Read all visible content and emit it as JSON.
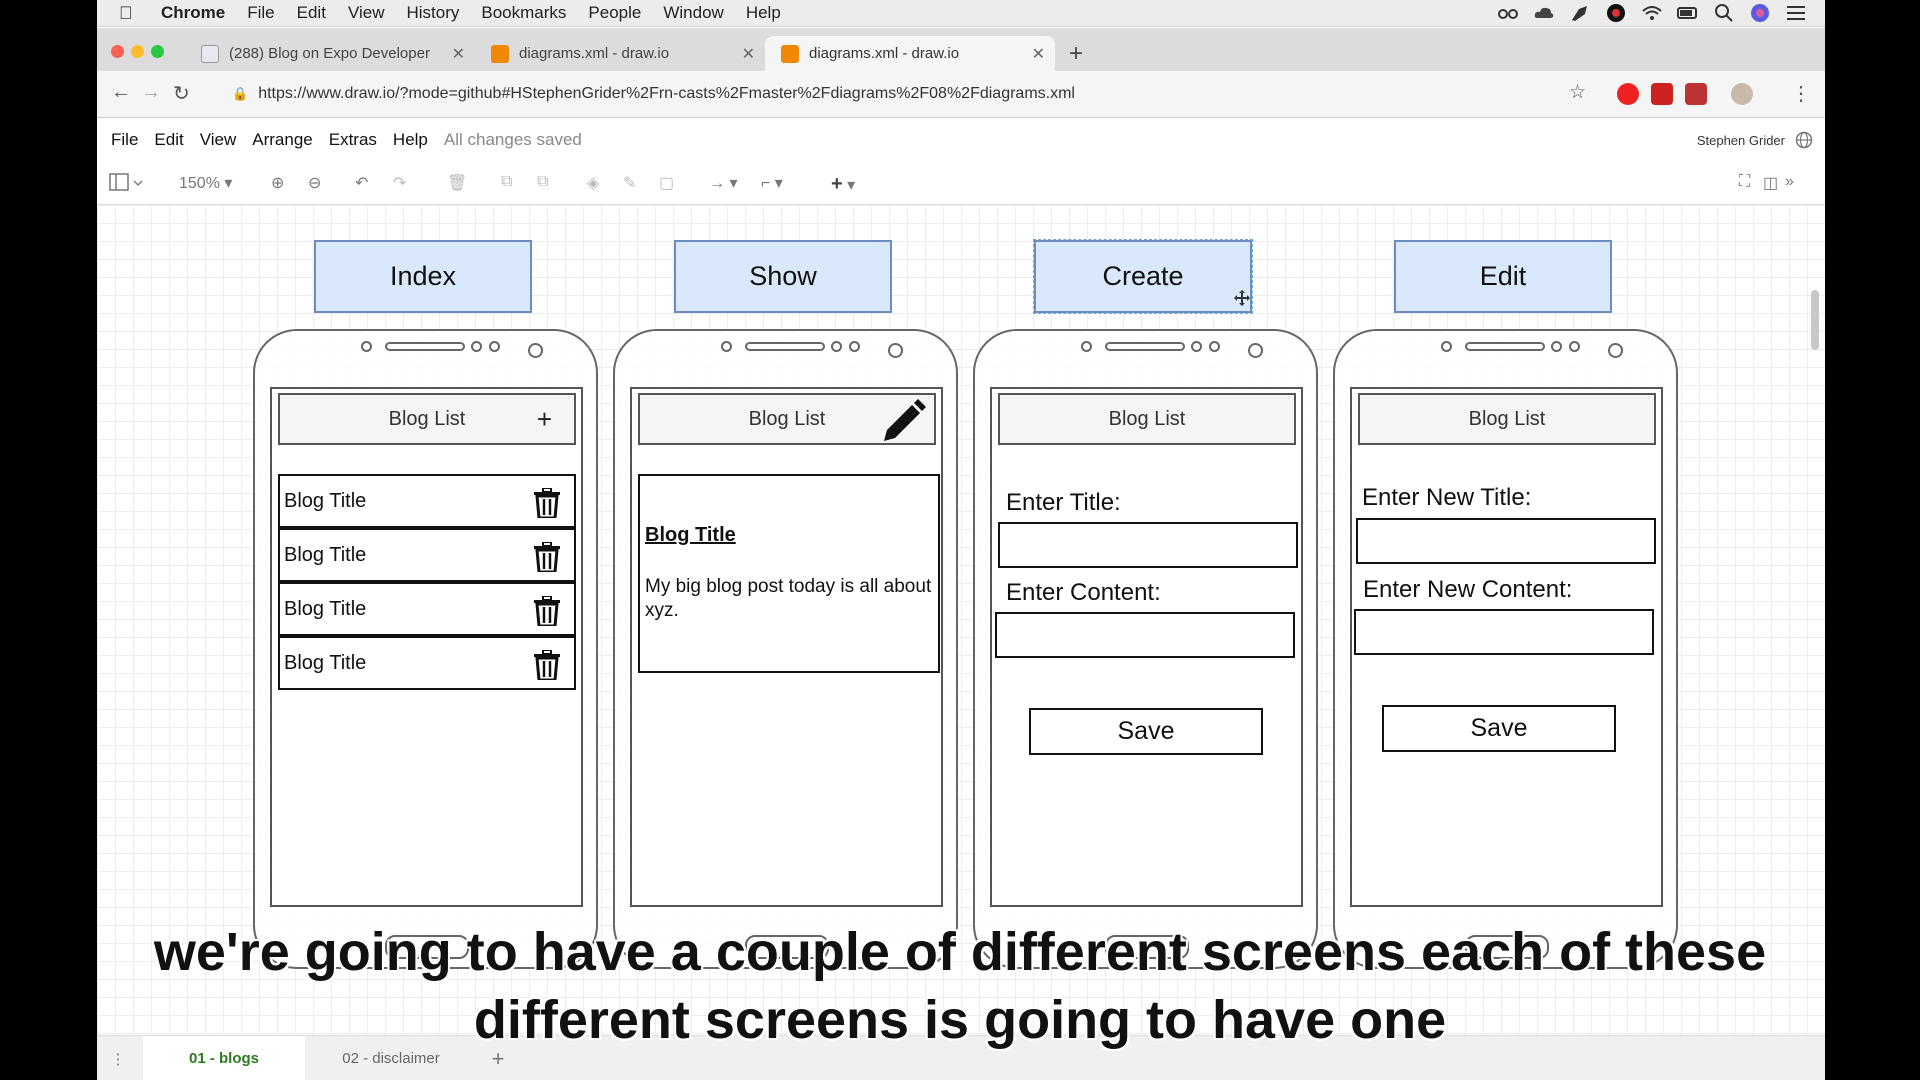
{
  "mac_menu": {
    "app": "Chrome",
    "items": [
      "File",
      "Edit",
      "View",
      "History",
      "Bookmarks",
      "People",
      "Window",
      "Help"
    ]
  },
  "tabs": [
    {
      "title": "(288) Blog on Expo Developer",
      "active": false
    },
    {
      "title": "diagrams.xml - draw.io",
      "active": false
    },
    {
      "title": "diagrams.xml - draw.io",
      "active": true
    }
  ],
  "address": {
    "url": "https://www.draw.io/?mode=github#HStephenGrider%2Frn-casts%2Fmaster%2Fdiagrams%2F08%2Fdiagrams.xml"
  },
  "drawio_menu": {
    "items": [
      "File",
      "Edit",
      "View",
      "Arrange",
      "Extras",
      "Help"
    ],
    "status": "All changes saved",
    "user": "Stephen Grider"
  },
  "toolbar": {
    "zoom": "150%"
  },
  "screens": [
    {
      "header": "Index",
      "navbar": "Blog List",
      "nav_icon": "plus-icon",
      "rows": [
        "Blog Title",
        "Blog Title",
        "Blog Title",
        "Blog Title"
      ]
    },
    {
      "header": "Show",
      "navbar": "Blog List",
      "nav_icon": "pencil-icon",
      "post_title": "Blog Title",
      "post_body": "My big blog post today is all about xyz."
    },
    {
      "header": "Create",
      "navbar": "Blog List",
      "title_label": "Enter Title:",
      "content_label": "Enter Content:",
      "save_label": "Save"
    },
    {
      "header": "Edit",
      "navbar": "Blog List",
      "title_label": "Enter New Title:",
      "content_label": "Enter New Content:",
      "save_label": "Save"
    }
  ],
  "page_tabs": [
    {
      "label": "01 - blogs",
      "active": true
    },
    {
      "label": "02 - disclaimer",
      "active": false
    }
  ],
  "subtitles": {
    "line1": "we're going to have a couple of different screens each of these",
    "line2": "different screens is going to have one"
  },
  "colors": {
    "header_fill": "#dae8fc",
    "header_stroke": "#6c8ebf",
    "active_page_tab": "#2d7a1f"
  }
}
